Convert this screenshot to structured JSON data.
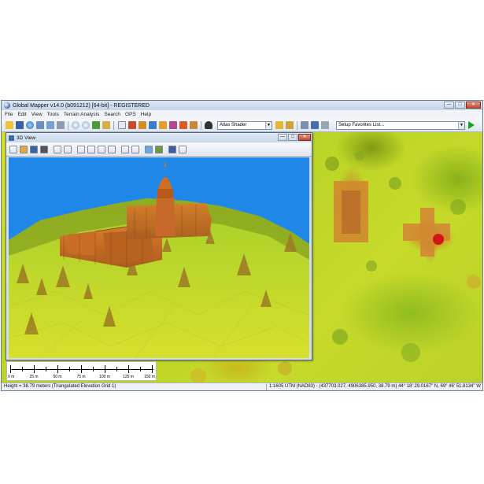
{
  "window": {
    "title": "Global Mapper v14.0 (b091212) [64-bit] - REGISTERED",
    "minimize_glyph": "—",
    "maximize_glyph": "□",
    "close_glyph": "✕"
  },
  "menu": [
    "File",
    "Edit",
    "View",
    "Tools",
    "Terrain Analysis",
    "Search",
    "GPS",
    "Help"
  ],
  "toolbar": {
    "shader_select": "Atlas Shader",
    "favorites_select": "Setup Favorites List...",
    "dropdown_glyph": "▼",
    "icons": [
      "open-folder-icon",
      "save-icon",
      "globe-icon",
      "layer-control-icon",
      "connect-icon",
      "config-icon",
      "zoom-in-icon",
      "zoom-out-icon",
      "full-view-icon",
      "home-icon",
      "pointer-icon",
      "digitizer-icon",
      "measure-icon",
      "feature-info-icon",
      "path-profile-icon",
      "view-shed-icon",
      "3d-view-icon",
      "binoculars-icon"
    ],
    "accent_run": "#18a418"
  },
  "view3d": {
    "title": "3D View",
    "minimize_glyph": "—",
    "maximize_glyph": "□",
    "close_glyph": "✕",
    "tool_icons": [
      "move-icon",
      "pan-icon",
      "record-icon",
      "binoculars-icon",
      "copy-icon",
      "home-icon",
      "rotate-left-icon",
      "rotate-right-icon",
      "tilt-up-icon",
      "tilt-down-icon",
      "zoom-in-icon",
      "zoom-out-icon",
      "lighting-icon",
      "grid-icon",
      "save-icon",
      "print-icon"
    ],
    "sky_color": "#1f87e8"
  },
  "scale_bar": {
    "labels": [
      "0 m",
      "25 m",
      "50 m",
      "75 m",
      "100 m",
      "125 m",
      "150 m"
    ]
  },
  "status_bar": {
    "left": "Height = 38.79 meters (Triangulated Elevation Grid 1)",
    "right": "1:1605   UTM (NAD83) - (437703.027, 4906385.950, 38.79 m)   44° 18' 29.0167\" N, 69° 46' 51.8134\" W"
  }
}
